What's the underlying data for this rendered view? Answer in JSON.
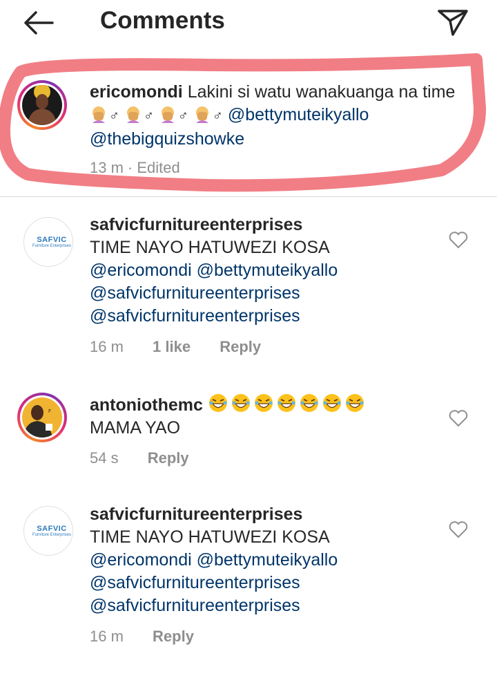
{
  "header": {
    "title": "Comments"
  },
  "caption": {
    "username": "ericomondi",
    "text": "Lakini si watu wanakuanga na time",
    "emojis": "🤦‍♂️🤦‍♂️🤦‍♂️🤦‍♂️",
    "mention1": "@bettymuteikyallo",
    "mention2": "@thebigquizshowke",
    "time": "13 m",
    "edited": "· Edited"
  },
  "comments": [
    {
      "username": "safvicfurnitureenterprises",
      "text": "TIME NAYO HATUWEZI KOSA",
      "mention_line1": "@ericomondi @bettymuteikyallo",
      "mention_line2": "@safvicfurnitureenterprises",
      "mention_line3": "@safvicfurnitureenterprises",
      "time": "16 m",
      "likes": "1 like",
      "reply": "Reply",
      "logo_word": "SAFVIC",
      "logo_sub": "Furniture Enterprises"
    },
    {
      "username": "antoniothemc",
      "emojis": "😂😂😂😂😂😂😂",
      "text": "MAMA YAO",
      "time": "54 s",
      "reply": "Reply"
    },
    {
      "username": "safvicfurnitureenterprises",
      "text": "TIME NAYO HATUWEZI KOSA",
      "mention_line1": "@ericomondi @bettymuteikyallo",
      "mention_line2": "@safvicfurnitureenterprises",
      "mention_line3": "@safvicfurnitureenterprises",
      "time": "16 m",
      "reply": "Reply",
      "logo_word": "SAFVIC",
      "logo_sub": "Furniture Enterprises"
    }
  ],
  "icons": {
    "back": "back-arrow-icon",
    "send": "paper-plane-icon",
    "like": "heart-outline-icon"
  },
  "colors": {
    "mention": "#003569",
    "meta": "#8e8e8e",
    "highlight": "#f07078"
  }
}
